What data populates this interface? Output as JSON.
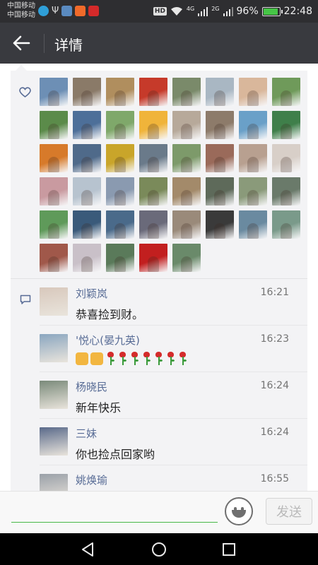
{
  "status_bar": {
    "carrier_1": "中国移动",
    "carrier_2": "中国移动",
    "network_badge": "HD",
    "signal_1": "4G",
    "signal_2": "2G",
    "battery_percent": "96%",
    "battery_level": 0.96,
    "time": "22:48"
  },
  "header": {
    "title": "详情",
    "back_icon": "arrow-left-icon"
  },
  "likes": {
    "icon": "heart-icon",
    "avatar_colors": [
      "#6d8fb5",
      "#8a7a68",
      "#b08e5e",
      "#c63a2a",
      "#7a8a6a",
      "#a9b7c3",
      "#d9b79b",
      "#6f9a5a",
      "#5b8b4a",
      "#4d6f99",
      "#7fa86a",
      "#f0b43a",
      "#b7a99a",
      "#8d7b6a",
      "#6aa0c8",
      "#3f7f4a",
      "#d77a2a",
      "#4f6a8a",
      "#c9a52a",
      "#6a7a8a",
      "#7d9a6a",
      "#9a6a5a",
      "#b8a090",
      "#d8cfc8",
      "#c99aa0",
      "#b7c3cf",
      "#8a9ab0",
      "#7a8a5a",
      "#a38a6a",
      "#5e6a5a",
      "#8a9a7a",
      "#6a7a6a",
      "#5f9a5a",
      "#3a5a7a",
      "#4a6a8a",
      "#6a6a7a",
      "#9a8a7a",
      "#3a3a3a",
      "#6a8aa0",
      "#7a9a8a",
      "#a0584a",
      "#c9c0c8",
      "#5a7a5a",
      "#c21f1f",
      "#6a8a6a"
    ]
  },
  "comments": {
    "icon": "comment-icon",
    "items": [
      {
        "name": "刘颖岚",
        "time": "16:21",
        "text": "恭喜捡到财。",
        "avatar_color": "#d8c8bc"
      },
      {
        "name": "'悦心(晏九英)",
        "time": "16:23",
        "text": "",
        "avatar_color": "#8aa6c0",
        "emoji": [
          "thumbs-up-icon",
          "thumbs-up-icon",
          "rose-icon",
          "rose-icon",
          "rose-icon",
          "rose-icon",
          "rose-icon",
          "rose-icon",
          "rose-icon"
        ]
      },
      {
        "name": "杨晓民",
        "time": "16:24",
        "text": "新年快乐",
        "avatar_color": "#7a8a7a"
      },
      {
        "name": "三妹",
        "time": "16:24",
        "text": "你也捡点回家哟",
        "avatar_color": "#5a6a8a"
      },
      {
        "name": "姚焕瑜",
        "time": "16:55",
        "text": "",
        "avatar_color": "#9aa0a8"
      }
    ]
  },
  "input_bar": {
    "placeholder": "",
    "emoji_icon": "smiley-icon",
    "send_label": "发送"
  },
  "nav_bar": {
    "back": "triangle-back-icon",
    "home": "circle-home-icon",
    "recents": "square-recents-icon"
  }
}
